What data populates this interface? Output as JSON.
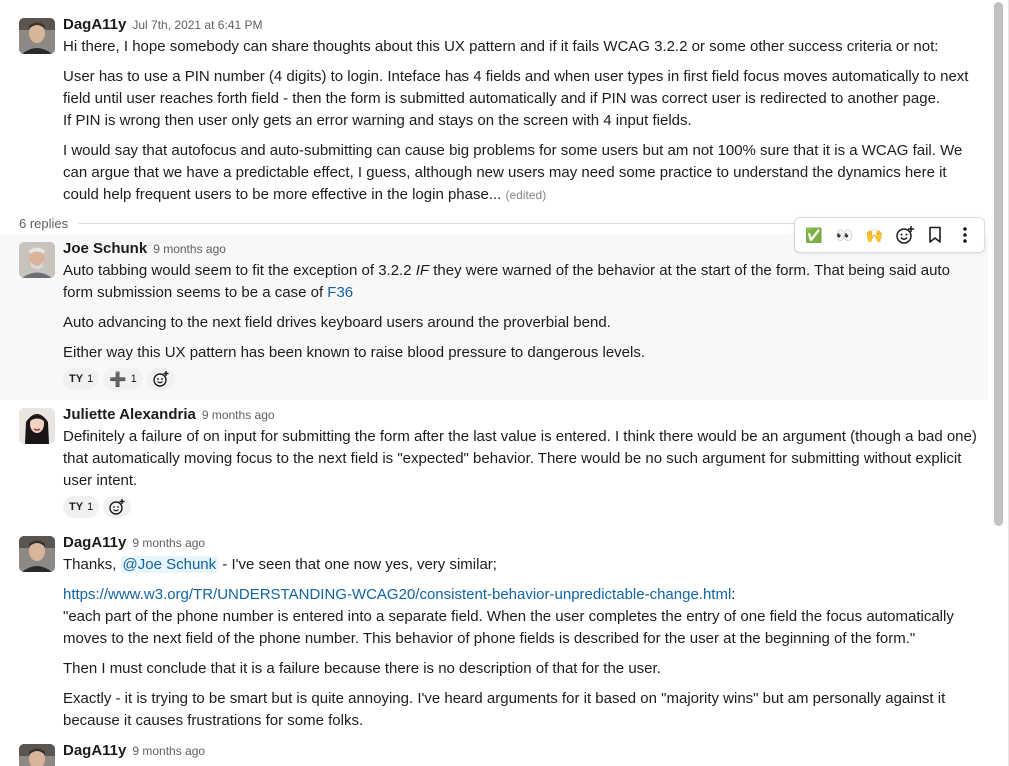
{
  "parent": {
    "author": "DagA11y",
    "timestamp": "Jul 7th, 2021 at 6:41 PM",
    "paragraphs": [
      "Hi there, I hope somebody can share thoughts about this UX pattern and if it fails WCAG 3.2.2 or some other success criteria or not:",
      "User has to use a PIN number (4 digits) to login. Inteface has 4 fields and when user types in first field focus moves automatically to next field until user reaches forth field - then the form is submitted automatically and if PIN was correct user is redirected to another page.",
      "If PIN is wrong then user only gets an error warning and stays on the screen with 4 input fields.",
      "I would say that autofocus and auto-submitting can cause big problems for some users but am not 100% sure that it is a WCAG fail. We can argue that we have a predictable effect, I guess, although new users may need some practice to understand the dynamics here it could help frequent users to be more effective in the login phase..."
    ],
    "edited_label": "(edited)"
  },
  "replies_count": "6 replies",
  "toolbar": {
    "check_emoji": "✅",
    "eyes_emoji": "👀",
    "raised_hands_emoji": "🙌"
  },
  "replies": [
    {
      "author": "Joe Schunk",
      "timestamp": "9 months ago",
      "p1_before": "Auto tabbing would seem to fit the exception of 3.2.2 ",
      "p1_italic": "IF",
      "p1_after": " they were warned of the behavior at the start of the form.  That being said auto form submission seems to be a case of ",
      "p1_link": "F36",
      "p2": "Auto advancing to the next field drives keyboard users around the proverbial bend.",
      "p3": "Either way this UX pattern has been known to raise blood pressure to dangerous levels.",
      "reactions": [
        {
          "emoji": "TY",
          "count": "1"
        },
        {
          "emoji": "➕",
          "count": "1"
        }
      ]
    },
    {
      "author": "Juliette Alexandria",
      "timestamp": "9 months ago",
      "p1": "Definitely a failure of on input for submitting the form after the last value is entered. I think there would be an argument (though a bad one) that automatically moving focus to the next field is \"expected\" behavior. There would be no such argument for submitting without explicit user intent.",
      "reactions": [
        {
          "emoji": "TY",
          "count": "1"
        }
      ]
    },
    {
      "author": "DagA11y",
      "timestamp": "9 months ago",
      "p1_before": "Thanks, ",
      "p1_mention": "@Joe Schunk",
      "p1_after": " - I've seen that one now yes, very similar;",
      "link": "https://www.w3.org/TR/UNDERSTANDING-WCAG20/consistent-behavior-unpredictable-change.html",
      "link_suffix": ":",
      "quote": "\"each part of the phone number is entered into a separate field. When the user completes the entry of one field the focus automatically moves to the next field of the phone number. This behavior of phone fields is described for the user at the beginning of the form.\"",
      "p3": "Then I must conclude that it is a failure because there is no description of that for the user.",
      "p4": "Exactly - it is trying to be smart but is quite annoying. I've heard arguments for it based on \"majority wins\" but am personally against it because it causes frustrations for some folks."
    },
    {
      "author": "DagA11y",
      "timestamp": "9 months ago"
    }
  ]
}
